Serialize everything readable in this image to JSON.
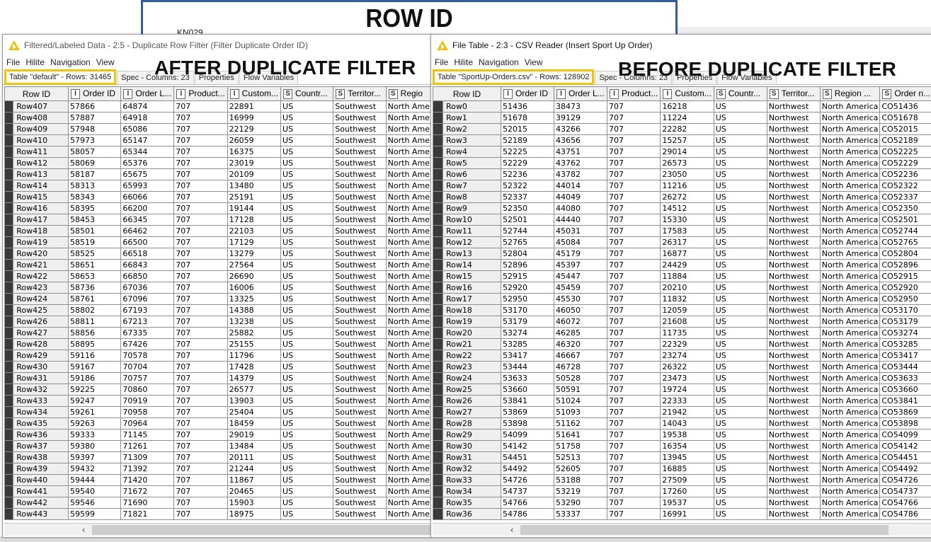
{
  "slide": {
    "title": "ROW ID",
    "subtext": "KN029"
  },
  "labels": {
    "after": "AFTER DUPLICATE FILTER",
    "before": "BEFORE DUPLICATE FILTER"
  },
  "highlight_color": "#f5c400",
  "left_window": {
    "title": "Filtered/Labeled Data - 2:5 - Duplicate Row Filter (Filter Duplicate Order ID)",
    "menu": [
      "File",
      "Hilite",
      "Navigation",
      "View"
    ],
    "tabs": [
      "Table \"default\" - Rows: 31465",
      "Spec - Columns: 23",
      "Properties",
      "Flow Variables"
    ],
    "columns": [
      {
        "type": "",
        "label": "Row ID"
      },
      {
        "type": "I",
        "label": "Order ID"
      },
      {
        "type": "I",
        "label": "Order L..."
      },
      {
        "type": "I",
        "label": "Product..."
      },
      {
        "type": "I",
        "label": "Custom..."
      },
      {
        "type": "S",
        "label": "Countr..."
      },
      {
        "type": "S",
        "label": "Territor..."
      },
      {
        "type": "S",
        "label": "Regio"
      }
    ],
    "rows": [
      [
        "Row407",
        "57866",
        "64874",
        "707",
        "22891",
        "US",
        "Southwest",
        "North Ame"
      ],
      [
        "Row408",
        "57887",
        "64918",
        "707",
        "16999",
        "US",
        "Southwest",
        "North Ame"
      ],
      [
        "Row409",
        "57948",
        "65086",
        "707",
        "22129",
        "US",
        "Southwest",
        "North Ame"
      ],
      [
        "Row410",
        "57973",
        "65147",
        "707",
        "26059",
        "US",
        "Southwest",
        "North Ame"
      ],
      [
        "Row411",
        "58057",
        "65344",
        "707",
        "16375",
        "US",
        "Southwest",
        "North Ame"
      ],
      [
        "Row412",
        "58069",
        "65376",
        "707",
        "23019",
        "US",
        "Southwest",
        "North Ame"
      ],
      [
        "Row413",
        "58187",
        "65675",
        "707",
        "20109",
        "US",
        "Southwest",
        "North Ame"
      ],
      [
        "Row414",
        "58313",
        "65993",
        "707",
        "13480",
        "US",
        "Southwest",
        "North Ame"
      ],
      [
        "Row415",
        "58343",
        "66066",
        "707",
        "25191",
        "US",
        "Southwest",
        "North Ame"
      ],
      [
        "Row416",
        "58395",
        "66200",
        "707",
        "19144",
        "US",
        "Southwest",
        "North Ame"
      ],
      [
        "Row417",
        "58453",
        "66345",
        "707",
        "17128",
        "US",
        "Southwest",
        "North Ame"
      ],
      [
        "Row418",
        "58501",
        "66462",
        "707",
        "22103",
        "US",
        "Southwest",
        "North Ame"
      ],
      [
        "Row419",
        "58519",
        "66500",
        "707",
        "17129",
        "US",
        "Southwest",
        "North Ame"
      ],
      [
        "Row420",
        "58525",
        "66518",
        "707",
        "13279",
        "US",
        "Southwest",
        "North Ame"
      ],
      [
        "Row421",
        "58651",
        "66843",
        "707",
        "27564",
        "US",
        "Southwest",
        "North Ame"
      ],
      [
        "Row422",
        "58653",
        "66850",
        "707",
        "26690",
        "US",
        "Southwest",
        "North Ame"
      ],
      [
        "Row423",
        "58736",
        "67036",
        "707",
        "16006",
        "US",
        "Southwest",
        "North Ame"
      ],
      [
        "Row424",
        "58761",
        "67096",
        "707",
        "13325",
        "US",
        "Southwest",
        "North Ame"
      ],
      [
        "Row425",
        "58802",
        "67193",
        "707",
        "14388",
        "US",
        "Southwest",
        "North Ame"
      ],
      [
        "Row426",
        "58811",
        "67213",
        "707",
        "13238",
        "US",
        "Southwest",
        "North Ame"
      ],
      [
        "Row427",
        "58856",
        "67335",
        "707",
        "25882",
        "US",
        "Southwest",
        "North Ame"
      ],
      [
        "Row428",
        "58895",
        "67426",
        "707",
        "25155",
        "US",
        "Southwest",
        "North Ame"
      ],
      [
        "Row429",
        "59116",
        "70578",
        "707",
        "11796",
        "US",
        "Southwest",
        "North Ame"
      ],
      [
        "Row430",
        "59167",
        "70704",
        "707",
        "17428",
        "US",
        "Southwest",
        "North Ame"
      ],
      [
        "Row431",
        "59186",
        "70757",
        "707",
        "14379",
        "US",
        "Southwest",
        "North Ame"
      ],
      [
        "Row432",
        "59225",
        "70860",
        "707",
        "26577",
        "US",
        "Southwest",
        "North Ame"
      ],
      [
        "Row433",
        "59247",
        "70919",
        "707",
        "13903",
        "US",
        "Southwest",
        "North Ame"
      ],
      [
        "Row434",
        "59261",
        "70958",
        "707",
        "25404",
        "US",
        "Southwest",
        "North Ame"
      ],
      [
        "Row435",
        "59263",
        "70964",
        "707",
        "18459",
        "US",
        "Southwest",
        "North Ame"
      ],
      [
        "Row436",
        "59333",
        "71145",
        "707",
        "29019",
        "US",
        "Southwest",
        "North Ame"
      ],
      [
        "Row437",
        "59380",
        "71261",
        "707",
        "13484",
        "US",
        "Southwest",
        "North Ame"
      ],
      [
        "Row438",
        "59397",
        "71309",
        "707",
        "20111",
        "US",
        "Southwest",
        "North Ame"
      ],
      [
        "Row439",
        "59432",
        "71392",
        "707",
        "21244",
        "US",
        "Southwest",
        "North Ame"
      ],
      [
        "Row440",
        "59444",
        "71420",
        "707",
        "11867",
        "US",
        "Southwest",
        "North Ame"
      ],
      [
        "Row441",
        "59540",
        "71672",
        "707",
        "20465",
        "US",
        "Southwest",
        "North Ame"
      ],
      [
        "Row442",
        "59546",
        "71690",
        "707",
        "15903",
        "US",
        "Southwest",
        "North Ame"
      ],
      [
        "Row443",
        "59599",
        "71821",
        "707",
        "18975",
        "US",
        "Southwest",
        "North Ame"
      ]
    ]
  },
  "right_window": {
    "title": "File Table - 2:3 - CSV Reader (Insert Sport Up Order)",
    "menu": [
      "File",
      "Hilite",
      "Navigation",
      "View"
    ],
    "tabs": [
      "Table \"SportUp-Orders.csv\" - Rows: 128902",
      "Spec - Columns: 23",
      "Properties",
      "Flow Variables"
    ],
    "columns": [
      {
        "type": "",
        "label": "Row ID"
      },
      {
        "type": "I",
        "label": "Order ID"
      },
      {
        "type": "I",
        "label": "Order L..."
      },
      {
        "type": "I",
        "label": "Product..."
      },
      {
        "type": "I",
        "label": "Custom..."
      },
      {
        "type": "S",
        "label": "Countr..."
      },
      {
        "type": "S",
        "label": "Territor..."
      },
      {
        "type": "S",
        "label": "Region ..."
      },
      {
        "type": "S",
        "label": "Order n..."
      }
    ],
    "rows": [
      [
        "Row0",
        "51436",
        "38473",
        "707",
        "16218",
        "US",
        "Northwest",
        "North America",
        "CO51436"
      ],
      [
        "Row1",
        "51678",
        "39129",
        "707",
        "11224",
        "US",
        "Northwest",
        "North America",
        "CO51678"
      ],
      [
        "Row2",
        "52015",
        "43266",
        "707",
        "22282",
        "US",
        "Northwest",
        "North America",
        "CO52015"
      ],
      [
        "Row3",
        "52189",
        "43656",
        "707",
        "15257",
        "US",
        "Northwest",
        "North America",
        "CO52189"
      ],
      [
        "Row4",
        "52225",
        "43751",
        "707",
        "29014",
        "US",
        "Northwest",
        "North America",
        "CO52225"
      ],
      [
        "Row5",
        "52229",
        "43762",
        "707",
        "26573",
        "US",
        "Northwest",
        "North America",
        "CO52229"
      ],
      [
        "Row6",
        "52236",
        "43782",
        "707",
        "23050",
        "US",
        "Northwest",
        "North America",
        "CO52236"
      ],
      [
        "Row7",
        "52322",
        "44014",
        "707",
        "11216",
        "US",
        "Northwest",
        "North America",
        "CO52322"
      ],
      [
        "Row8",
        "52337",
        "44049",
        "707",
        "26272",
        "US",
        "Northwest",
        "North America",
        "CO52337"
      ],
      [
        "Row9",
        "52350",
        "44080",
        "707",
        "14512",
        "US",
        "Northwest",
        "North America",
        "CO52350"
      ],
      [
        "Row10",
        "52501",
        "44440",
        "707",
        "15330",
        "US",
        "Northwest",
        "North America",
        "CO52501"
      ],
      [
        "Row11",
        "52744",
        "45031",
        "707",
        "17583",
        "US",
        "Northwest",
        "North America",
        "CO52744"
      ],
      [
        "Row12",
        "52765",
        "45084",
        "707",
        "26317",
        "US",
        "Northwest",
        "North America",
        "CO52765"
      ],
      [
        "Row13",
        "52804",
        "45179",
        "707",
        "16877",
        "US",
        "Northwest",
        "North America",
        "CO52804"
      ],
      [
        "Row14",
        "52896",
        "45397",
        "707",
        "24429",
        "US",
        "Northwest",
        "North America",
        "CO52896"
      ],
      [
        "Row15",
        "52915",
        "45447",
        "707",
        "11884",
        "US",
        "Northwest",
        "North America",
        "CO52915"
      ],
      [
        "Row16",
        "52920",
        "45459",
        "707",
        "20210",
        "US",
        "Northwest",
        "North America",
        "CO52920"
      ],
      [
        "Row17",
        "52950",
        "45530",
        "707",
        "11832",
        "US",
        "Northwest",
        "North America",
        "CO52950"
      ],
      [
        "Row18",
        "53170",
        "46050",
        "707",
        "12059",
        "US",
        "Northwest",
        "North America",
        "CO53170"
      ],
      [
        "Row19",
        "53179",
        "46072",
        "707",
        "21608",
        "US",
        "Northwest",
        "North America",
        "CO53179"
      ],
      [
        "Row20",
        "53274",
        "46285",
        "707",
        "11735",
        "US",
        "Northwest",
        "North America",
        "CO53274"
      ],
      [
        "Row21",
        "53285",
        "46320",
        "707",
        "22329",
        "US",
        "Northwest",
        "North America",
        "CO53285"
      ],
      [
        "Row22",
        "53417",
        "46667",
        "707",
        "23274",
        "US",
        "Northwest",
        "North America",
        "CO53417"
      ],
      [
        "Row23",
        "53444",
        "46728",
        "707",
        "26322",
        "US",
        "Northwest",
        "North America",
        "CO53444"
      ],
      [
        "Row24",
        "53633",
        "50528",
        "707",
        "23473",
        "US",
        "Northwest",
        "North America",
        "CO53633"
      ],
      [
        "Row25",
        "53660",
        "50591",
        "707",
        "19724",
        "US",
        "Northwest",
        "North America",
        "CO53660"
      ],
      [
        "Row26",
        "53841",
        "51024",
        "707",
        "22333",
        "US",
        "Northwest",
        "North America",
        "CO53841"
      ],
      [
        "Row27",
        "53869",
        "51093",
        "707",
        "21942",
        "US",
        "Northwest",
        "North America",
        "CO53869"
      ],
      [
        "Row28",
        "53898",
        "51162",
        "707",
        "14043",
        "US",
        "Northwest",
        "North America",
        "CO53898"
      ],
      [
        "Row29",
        "54099",
        "51641",
        "707",
        "19538",
        "US",
        "Northwest",
        "North America",
        "CO54099"
      ],
      [
        "Row30",
        "54142",
        "51758",
        "707",
        "16354",
        "US",
        "Northwest",
        "North America",
        "CO54142"
      ],
      [
        "Row31",
        "54451",
        "52513",
        "707",
        "13945",
        "US",
        "Northwest",
        "North America",
        "CO54451"
      ],
      [
        "Row32",
        "54492",
        "52605",
        "707",
        "16885",
        "US",
        "Northwest",
        "North America",
        "CO54492"
      ],
      [
        "Row33",
        "54726",
        "53188",
        "707",
        "27509",
        "US",
        "Northwest",
        "North America",
        "CO54726"
      ],
      [
        "Row34",
        "54737",
        "53219",
        "707",
        "17260",
        "US",
        "Northwest",
        "North America",
        "CO54737"
      ],
      [
        "Row35",
        "54766",
        "53290",
        "707",
        "19537",
        "US",
        "Northwest",
        "North America",
        "CO54766"
      ],
      [
        "Row36",
        "54786",
        "53337",
        "707",
        "16991",
        "US",
        "Northwest",
        "North America",
        "CO54786"
      ]
    ]
  },
  "scrollbar": {
    "left_arrow": "‹"
  }
}
